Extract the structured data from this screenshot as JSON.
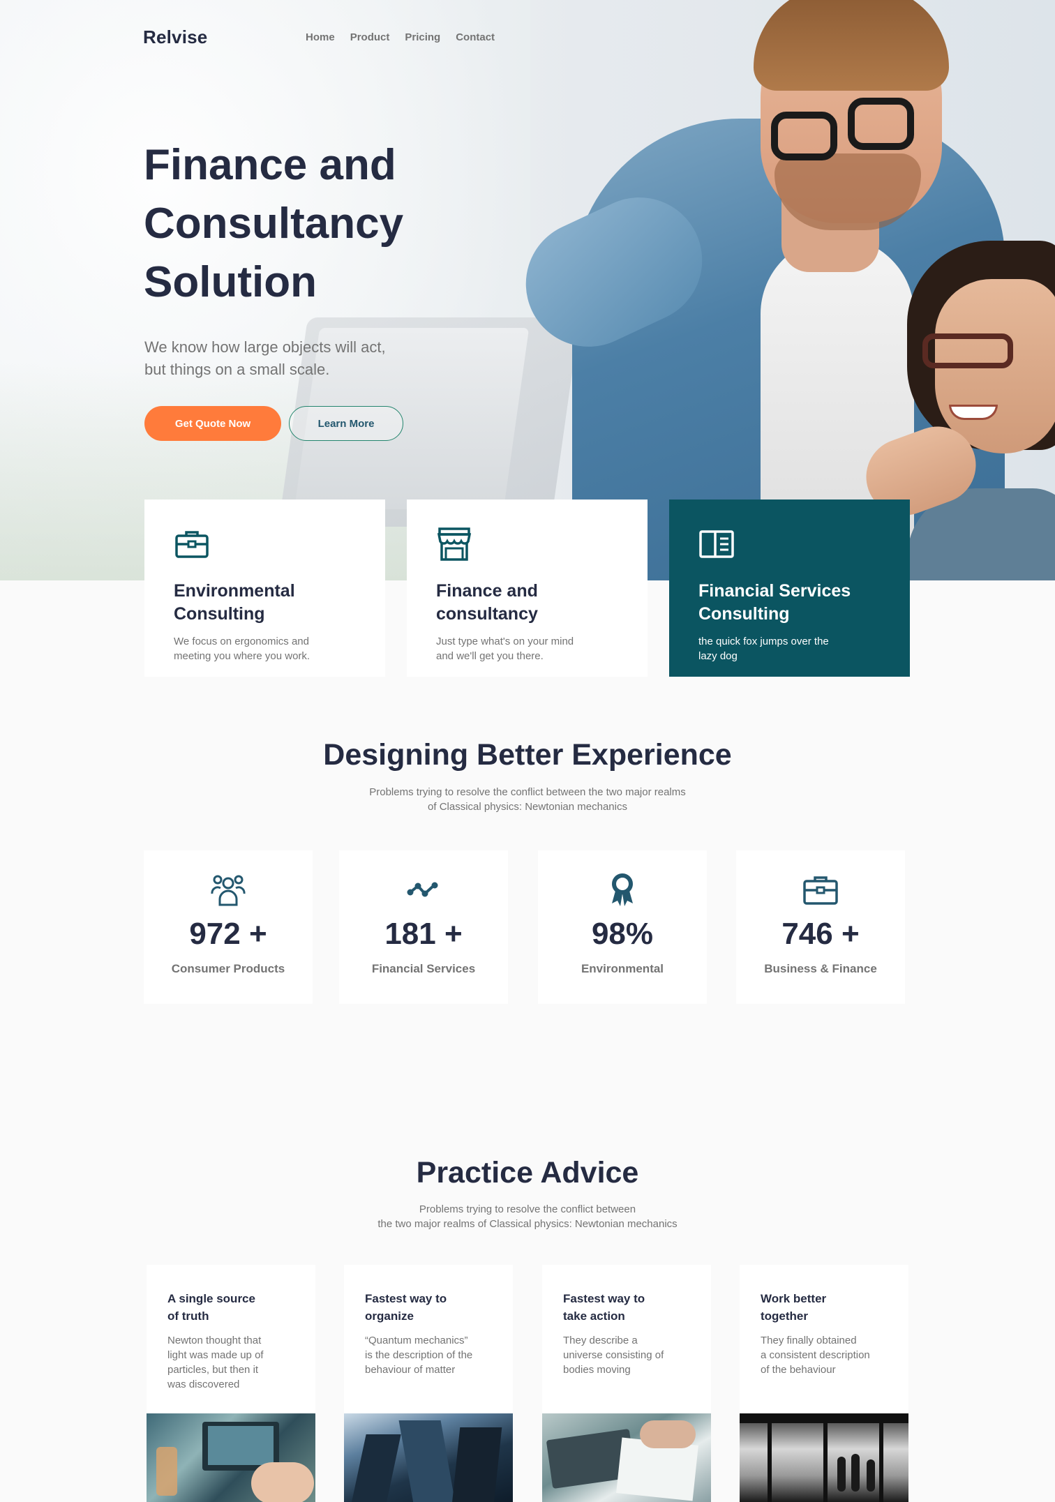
{
  "nav": {
    "brand": "Relvise",
    "links": [
      "Home",
      "Product",
      "Pricing",
      "Contact"
    ]
  },
  "hero": {
    "title_line1": "Finance and",
    "title_line2": "Consultancy",
    "title_line3": "Solution",
    "subtitle_line1": "We know how large objects will act,",
    "subtitle_line2": "but things on a small scale.",
    "primary_button": "Get Quote Now",
    "secondary_button": "Learn More"
  },
  "features": [
    {
      "icon": "briefcase-icon",
      "title_line1": "Environmental",
      "title_line2": "Consulting",
      "desc_line1": "We focus on ergonomics and",
      "desc_line2": "meeting you where you work."
    },
    {
      "icon": "store-icon",
      "title_line1": "Finance and",
      "title_line2": "consultancy",
      "desc_line1": "Just type what's on your mind",
      "desc_line2": "and we'll get you there."
    },
    {
      "icon": "book-open-icon",
      "title_line1": "Financial Services",
      "title_line2": "Consulting",
      "desc_line1": "the quick fox jumps over the",
      "desc_line2": "lazy dog"
    }
  ],
  "experience": {
    "title": "Designing Better Experience",
    "subtitle_line1": "Problems trying to resolve the conflict between the two major realms",
    "subtitle_line2": "of Classical physics: Newtonian mechanics"
  },
  "stats": [
    {
      "icon": "users-icon",
      "value": "972 +",
      "label": "Consumer Products"
    },
    {
      "icon": "trend-icon",
      "value": "181 +",
      "label": "Financial Services"
    },
    {
      "icon": "award-icon",
      "value": "98%",
      "label": "Environmental"
    },
    {
      "icon": "briefcase-icon",
      "value": "746 +",
      "label": "Business & Finance"
    }
  ],
  "practice": {
    "title": "Practice Advice",
    "subtitle_line1": "Problems trying to resolve the conflict between",
    "subtitle_line2": "the two major realms of Classical physics: Newtonian mechanics",
    "cards": [
      {
        "title_line1": "A single source",
        "title_line2": "of truth",
        "desc": [
          "Newton thought that",
          "light was made up of",
          "particles, but then it",
          "was discovered"
        ]
      },
      {
        "title_line1": "Fastest way to",
        "title_line2": "organize",
        "desc": [
          "“Quantum mechanics”",
          "is the description of the",
          "behaviour of matter",
          ""
        ]
      },
      {
        "title_line1": "Fastest way to",
        "title_line2": "take action",
        "desc": [
          "They describe a",
          "universe consisting of",
          "bodies moving",
          ""
        ]
      },
      {
        "title_line1": "Work better",
        "title_line2": "together",
        "desc": [
          "They finally obtained",
          "a consistent description",
          "of the behaviour",
          ""
        ]
      }
    ]
  },
  "colors": {
    "primary_text": "#252b42",
    "muted_text": "#737373",
    "accent_orange": "#ff7b3b",
    "accent_teal": "#0b5561",
    "icon_teal": "#23576e"
  }
}
